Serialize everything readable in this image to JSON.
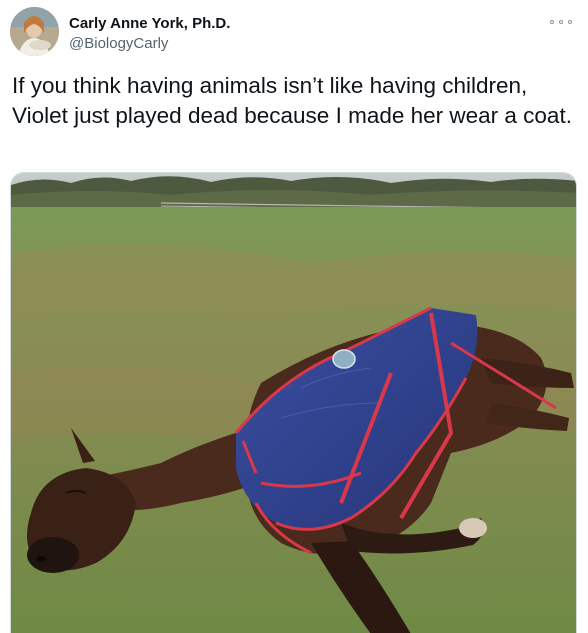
{
  "author": {
    "display_name": "Carly Anne York, Ph.D.",
    "handle": "@BiologyCarly"
  },
  "tweet": {
    "text": "If you think having animals isn’t like having children, Violet just played dead because I made her wear a coat."
  },
  "icons": {
    "more": "more-options-icon"
  },
  "colors": {
    "text": "#0f1419",
    "secondary": "#536471",
    "coat_blue": "#2e3f8a",
    "coat_trim": "#d9384a",
    "grass": "#7f8d4c"
  }
}
